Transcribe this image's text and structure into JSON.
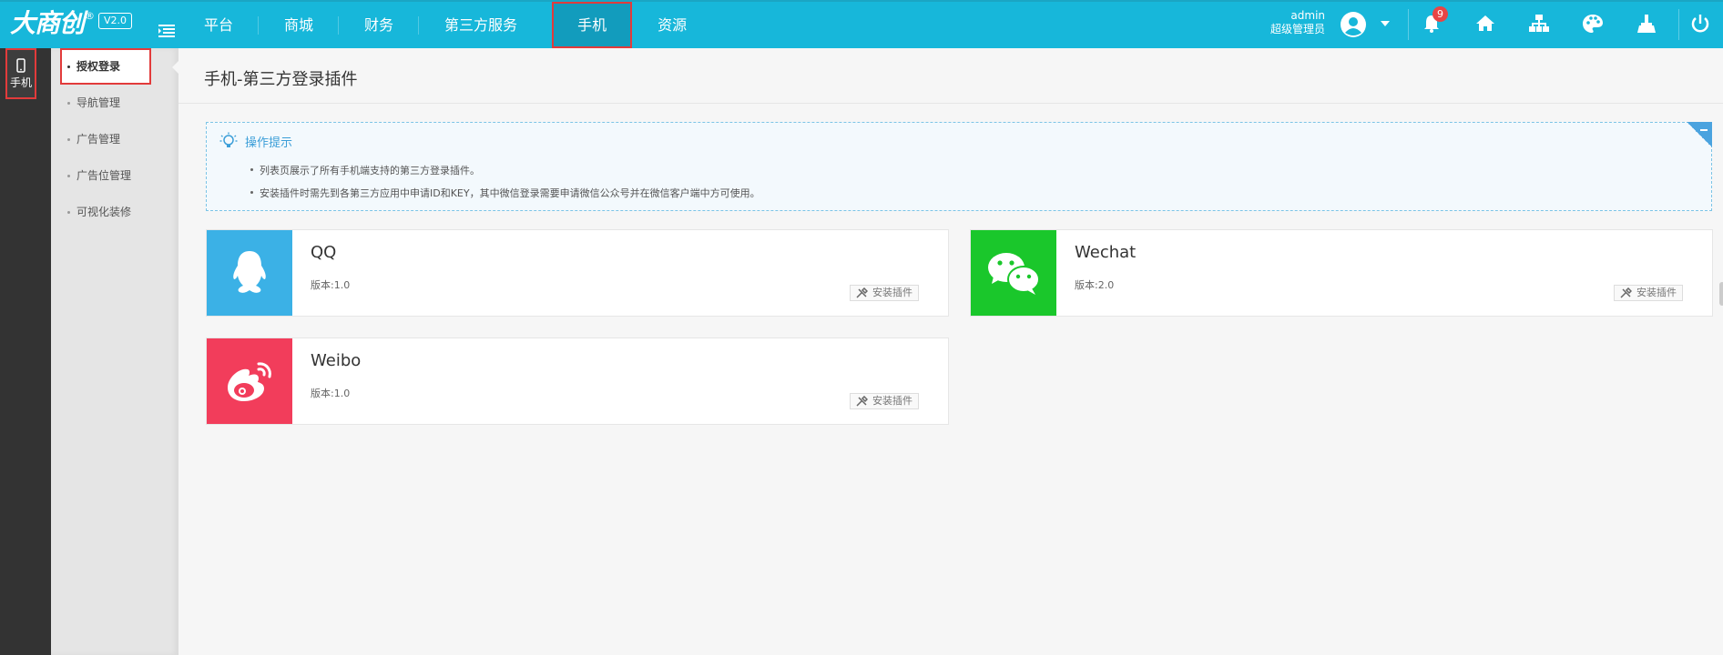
{
  "header": {
    "logo": "大商创",
    "logo_reg": "®",
    "version": "V2.0",
    "nav": [
      "平台",
      "商城",
      "财务",
      "第三方服务",
      "手机",
      "资源"
    ],
    "active_nav": "手机",
    "user_name": "admin",
    "user_role": "超级管理员",
    "notification_count": "9",
    "icons": [
      "bell-icon",
      "home-icon",
      "sitemap-icon",
      "palette-icon",
      "broom-icon",
      "power-icon"
    ]
  },
  "sidebar": {
    "module_label": "手机",
    "items": [
      "授权登录",
      "导航管理",
      "广告管理",
      "广告位管理",
      "可视化装修"
    ]
  },
  "main": {
    "title": "手机-第三方登录插件",
    "tips_title": "操作提示",
    "tips": [
      "列表页展示了所有手机端支持的第三方登录插件。",
      "安装插件时需先到各第三方应用中申请ID和KEY，其中微信登录需要申请微信公众号并在微信客户端中方可使用。"
    ],
    "plugins": [
      {
        "name": "QQ",
        "version": "版本:1.0",
        "button": "安装插件",
        "color": "#3bb1e6"
      },
      {
        "name": "Wechat",
        "version": "版本:2.0",
        "button": "安装插件",
        "color": "#1ac72b"
      },
      {
        "name": "Weibo",
        "version": "版本:1.0",
        "button": "安装插件",
        "color": "#f23d5b"
      }
    ]
  },
  "colors": {
    "topbar": "#17b7da",
    "active_nav": "#129cbd",
    "sidebar_dark": "#333333",
    "highlight_border": "#e23b3b"
  }
}
